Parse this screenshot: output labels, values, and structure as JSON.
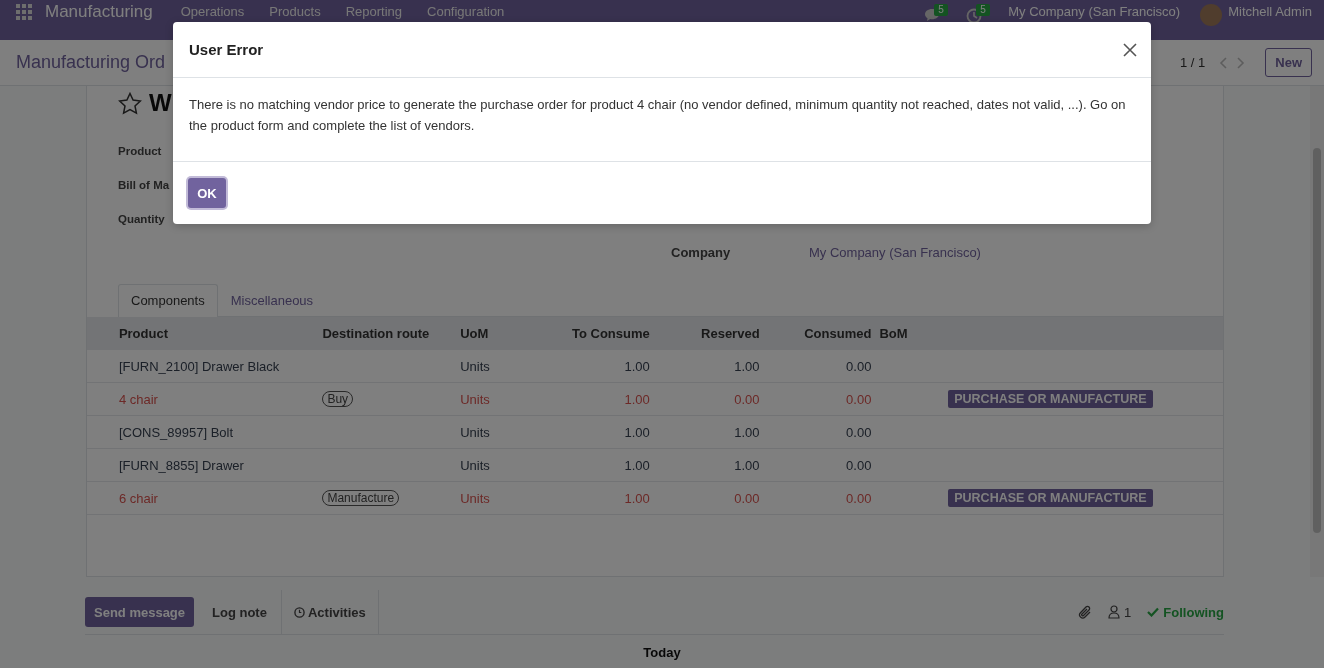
{
  "navbar": {
    "app_name": "Manufacturing",
    "menu": [
      "Operations",
      "Products",
      "Reporting",
      "Configuration"
    ],
    "messages_count": "5",
    "activities_count": "5",
    "company": "My Company (San Francisco)",
    "user": "Mitchell Admin"
  },
  "control_panel": {
    "breadcrumb": "Manufacturing Ord",
    "pager": "1 / 1",
    "new_button": "New"
  },
  "form": {
    "starred": false,
    "title": "W",
    "fields": [
      {
        "label": "Product"
      },
      {
        "label": "Bill of Ma"
      },
      {
        "label": "Quantity"
      }
    ],
    "company_label": "Company",
    "company_value": "My Company (San Francisco)",
    "tabs": [
      {
        "label": "Components",
        "selected": true
      },
      {
        "label": "Miscellaneous",
        "selected": false
      }
    ],
    "table": {
      "columns": [
        "Product",
        "Destination route",
        "UoM",
        "To Consume",
        "Reserved",
        "Consumed",
        "BoM"
      ],
      "rows": [
        {
          "product": "[FURN_2100] Drawer Black",
          "uom": "Units",
          "to_consume": "1.00",
          "reserved": "1.00",
          "consumed": "0.00",
          "shortage": false
        },
        {
          "product": "4 chair",
          "route": "Buy",
          "uom": "Units",
          "to_consume": "1.00",
          "reserved": "0.00",
          "consumed": "0.00",
          "shortage": true,
          "action": "PURCHASE OR MANUFACTURE"
        },
        {
          "product": "[CONS_89957] Bolt",
          "uom": "Units",
          "to_consume": "1.00",
          "reserved": "1.00",
          "consumed": "0.00",
          "shortage": false
        },
        {
          "product": "[FURN_8855] Drawer",
          "uom": "Units",
          "to_consume": "1.00",
          "reserved": "1.00",
          "consumed": "0.00",
          "shortage": false
        },
        {
          "product": "6 chair",
          "route": "Manufacture",
          "uom": "Units",
          "to_consume": "1.00",
          "reserved": "0.00",
          "consumed": "0.00",
          "shortage": true,
          "action": "PURCHASE OR MANUFACTURE"
        }
      ]
    }
  },
  "chatter": {
    "buttons": [
      {
        "label": "Send message",
        "selected": true
      },
      {
        "label": "Log note",
        "selected": false
      },
      {
        "label": "Activities",
        "selected": false
      }
    ],
    "followers_count": "1",
    "following": "Following",
    "date_separator": "Today"
  },
  "dialog": {
    "title": "User Error",
    "message": "There is no matching vendor price to generate the purchase order for product 4 chair (no vendor defined, minimum quantity not reached, dates not valid, ...). Go on the product form and complete the list of vendors.",
    "ok_button": "OK"
  }
}
